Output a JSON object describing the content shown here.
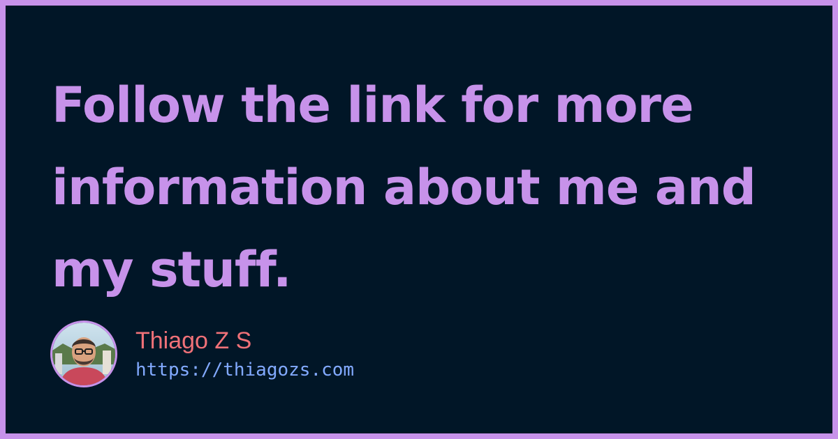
{
  "colors": {
    "frame": "#C792EA",
    "background": "#011627",
    "headline": "#C792EA",
    "name": "#F07178",
    "url": "#82AAFF"
  },
  "headline": "Follow the link for more information about me and my stuff.",
  "author": {
    "avatar_icon": "avatar-photo-icon",
    "name": "Thiago Z S",
    "url": "https://thiagozs.com"
  }
}
